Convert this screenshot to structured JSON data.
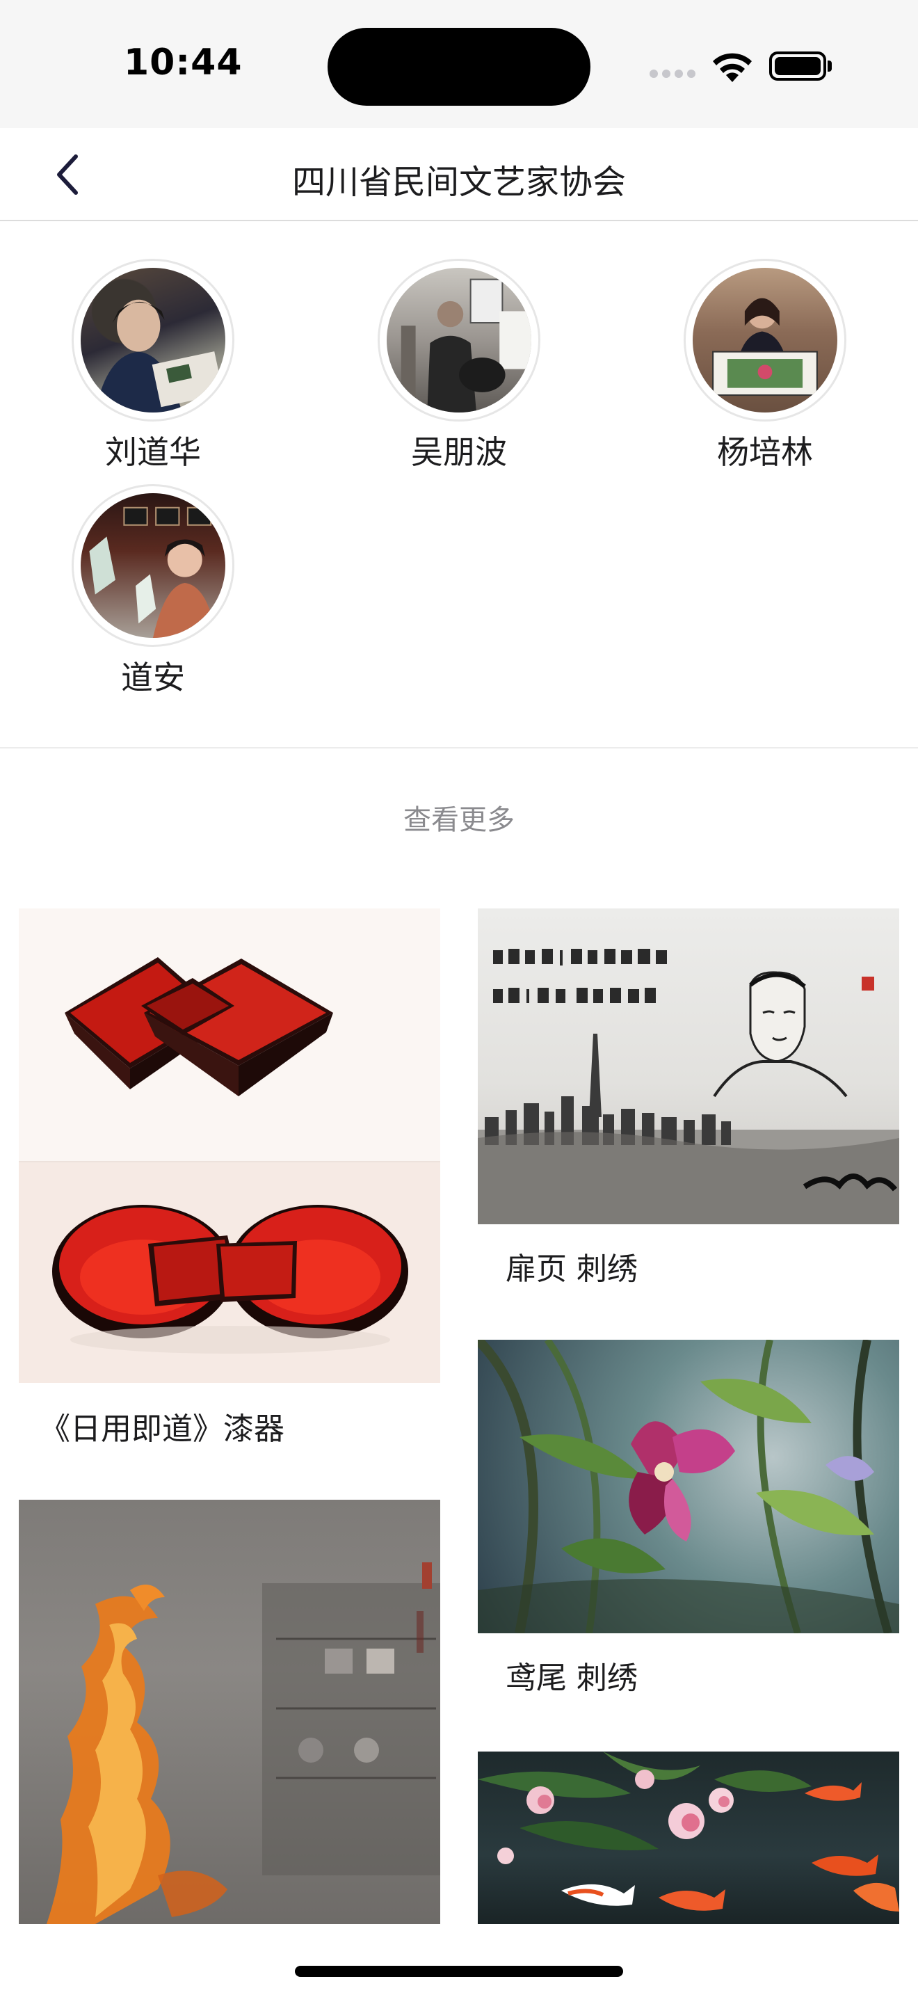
{
  "status": {
    "time": "10:44"
  },
  "header": {
    "title": "四川省民间文艺家协会"
  },
  "members": [
    {
      "name": "刘道华"
    },
    {
      "name": "吴朋波"
    },
    {
      "name": "杨培林"
    },
    {
      "name": "道安"
    }
  ],
  "see_more_label": "查看更多",
  "works": [
    {
      "title": "《日用即道》漆器",
      "image": "lacquerware-photo"
    },
    {
      "title": "扉页 刺绣",
      "image": "portrait-embroidery-photo"
    },
    {
      "title": "鸢尾 刺绣",
      "image": "iris-embroidery-photo"
    },
    {
      "title": "",
      "image": "phoenix-artwork-photo"
    },
    {
      "title": "",
      "image": "koi-embroidery-photo"
    }
  ],
  "image_caption_text": {
    "calligraphy": "",
    "seal": ""
  }
}
